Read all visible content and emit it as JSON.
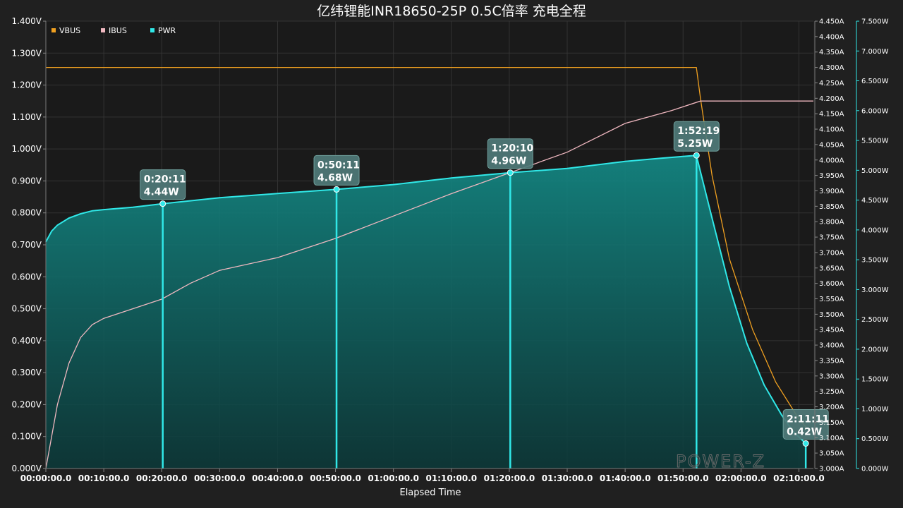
{
  "chart_data": {
    "type": "line",
    "title": "亿纬锂能INR18650-25P 0.5C倍率 充电全程",
    "xlabel": "Elapsed Time",
    "x_unit": "minutes",
    "x_ticks": [
      "00:00:00.0",
      "00:10:00.0",
      "00:20:00.0",
      "00:30:00.0",
      "00:40:00.0",
      "00:50:00.0",
      "01:00:00.0",
      "01:10:00.0",
      "01:20:00.0",
      "01:30:00.0",
      "01:40:00.0",
      "01:50:00.0",
      "02:00:00.0",
      "02:10:00.0"
    ],
    "xlim": [
      0,
      132.5
    ],
    "grid": true,
    "legend_position": "top-left",
    "axes": {
      "left": {
        "ylim": [
          0,
          1.4
        ],
        "ticks": [
          "0.000V",
          "0.100V",
          "0.200V",
          "0.300V",
          "0.400V",
          "0.500V",
          "0.600V",
          "0.700V",
          "0.800V",
          "0.900V",
          "1.000V",
          "1.100V",
          "1.200V",
          "1.300V",
          "1.400V"
        ],
        "color": "#ffffff"
      },
      "right1": {
        "ylim": [
          3.0,
          4.45
        ],
        "ticks": [
          "3.000A",
          "3.050A",
          "3.100A",
          "3.150A",
          "3.200A",
          "3.250A",
          "3.300A",
          "3.350A",
          "3.400A",
          "3.450A",
          "3.500A",
          "3.550A",
          "3.600A",
          "3.650A",
          "3.700A",
          "3.750A",
          "3.800A",
          "3.850A",
          "3.900A",
          "3.950A",
          "4.000A",
          "4.050A",
          "4.100A",
          "4.150A",
          "4.200A",
          "4.250A",
          "4.300A",
          "4.350A",
          "4.400A",
          "4.450A"
        ],
        "color": "#ffffff"
      },
      "right2": {
        "ylim": [
          0,
          7.5
        ],
        "ticks": [
          "0.000W",
          "0.500W",
          "1.000W",
          "1.500W",
          "2.000W",
          "2.500W",
          "3.000W",
          "3.500W",
          "4.000W",
          "4.500W",
          "5.000W",
          "5.500W",
          "6.000W",
          "6.500W",
          "7.000W",
          "7.500W"
        ],
        "color": "#30e8e8"
      }
    },
    "series": [
      {
        "name": "VBUS",
        "axis": "right1",
        "color": "#f0a020",
        "x": [
          0,
          112.3,
          113.0,
          115,
          118,
          122,
          126,
          130,
          131.2
        ],
        "y": [
          4.3,
          4.3,
          4.2,
          3.95,
          3.68,
          3.45,
          3.28,
          3.16,
          3.135
        ]
      },
      {
        "name": "IBUS",
        "axis": "left",
        "color": "#f0b8c0",
        "x": [
          0,
          2,
          4,
          6,
          8,
          10,
          15,
          20,
          25,
          30,
          40,
          50,
          60,
          70,
          80,
          90,
          100,
          108,
          113,
          132.5
        ],
        "y": [
          0.0,
          0.2,
          0.33,
          0.41,
          0.45,
          0.47,
          0.5,
          0.53,
          0.58,
          0.62,
          0.66,
          0.72,
          0.79,
          0.86,
          0.925,
          0.99,
          1.08,
          1.12,
          1.15,
          1.15
        ]
      },
      {
        "name": "PWR",
        "axis": "right2",
        "color": "#30e8e8",
        "x": [
          0,
          1,
          2,
          4,
          6,
          8,
          10,
          15,
          20.18,
          30,
          40,
          50.18,
          60,
          70,
          80.17,
          90,
          100,
          106,
          112.3,
          115,
          118,
          121,
          124,
          127,
          129,
          131.18
        ],
        "y": [
          3.8,
          3.98,
          4.08,
          4.2,
          4.27,
          4.32,
          4.34,
          4.38,
          4.44,
          4.54,
          4.61,
          4.68,
          4.76,
          4.87,
          4.96,
          5.03,
          5.15,
          5.2,
          5.25,
          4.2,
          3.05,
          2.1,
          1.4,
          0.9,
          0.62,
          0.42
        ]
      }
    ],
    "markers": [
      {
        "x": 20.18,
        "y": 4.44,
        "time": "0:20:11",
        "value": "4.44W"
      },
      {
        "x": 50.18,
        "y": 4.68,
        "time": "0:50:11",
        "value": "4.68W"
      },
      {
        "x": 80.17,
        "y": 4.96,
        "time": "1:20:10",
        "value": "4.96W"
      },
      {
        "x": 112.32,
        "y": 5.25,
        "time": "1:52:19",
        "value": "5.25W"
      },
      {
        "x": 131.18,
        "y": 0.42,
        "time": "2:11:11",
        "value": "0.42W"
      }
    ],
    "watermark": "POWER-Z"
  }
}
